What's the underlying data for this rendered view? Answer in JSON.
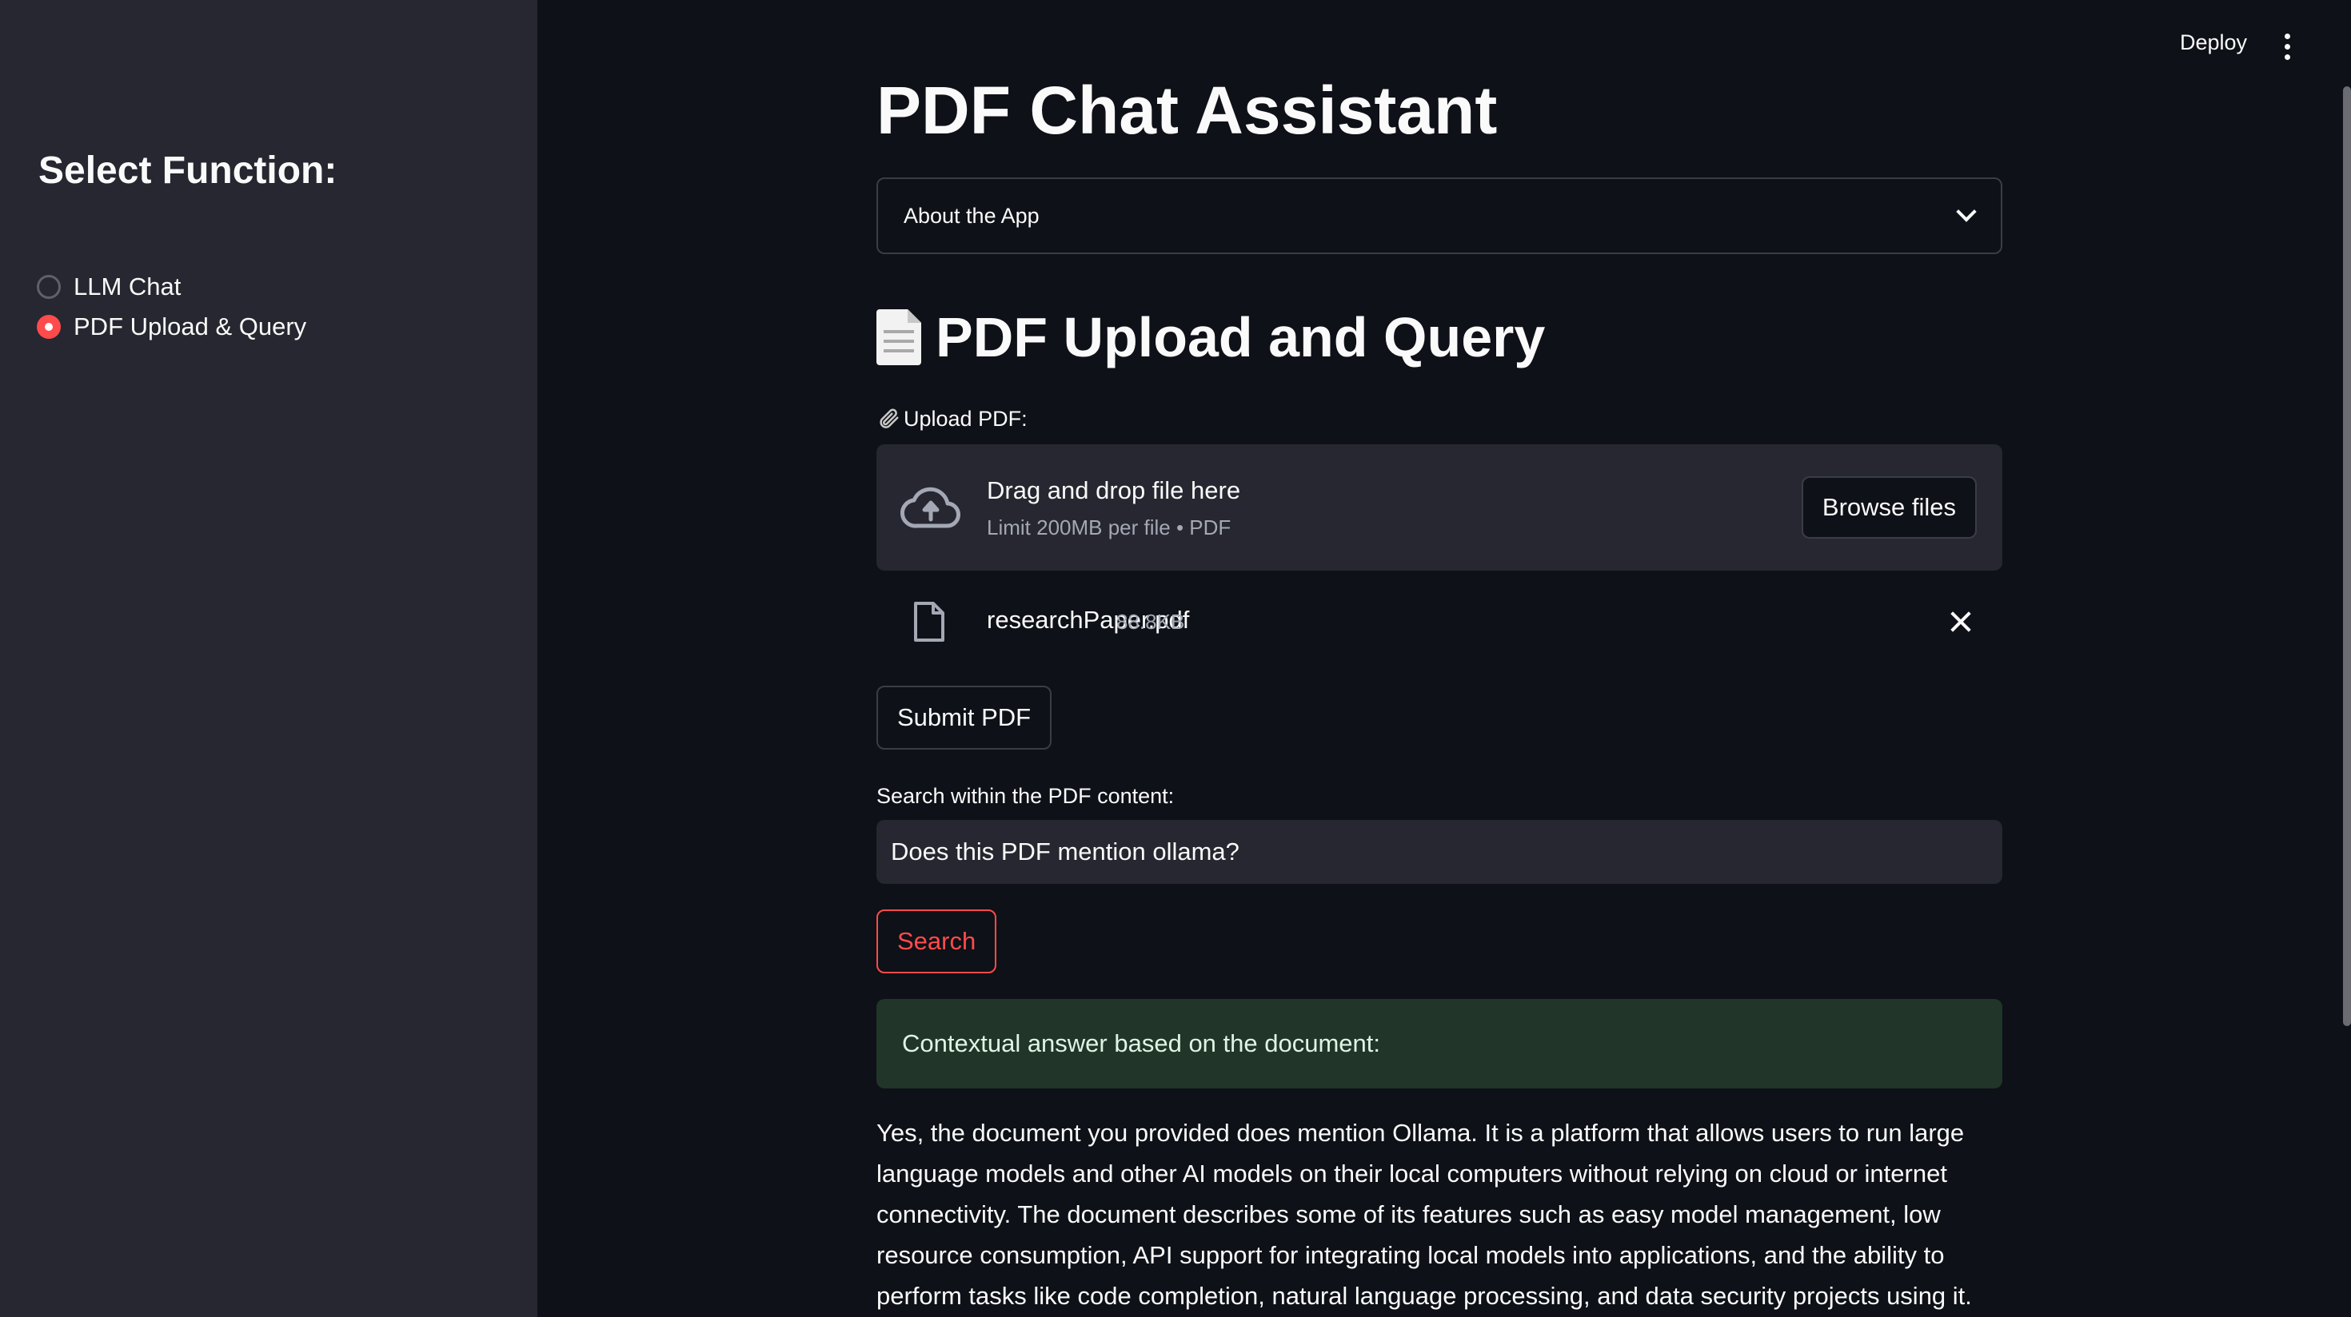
{
  "sidebar": {
    "title": "Select Function:",
    "options": [
      {
        "label": "LLM Chat",
        "selected": false
      },
      {
        "label": "PDF Upload & Query",
        "selected": true
      }
    ]
  },
  "header": {
    "deploy_label": "Deploy",
    "menu_icon": "more-vertical-icon"
  },
  "main": {
    "title": "PDF Chat Assistant",
    "expander_label": "About the App",
    "section_title": "PDF Upload and Query",
    "section_icon": "page-facing-up-icon",
    "upload": {
      "label": "Upload PDF:",
      "label_icon": "paperclip-icon",
      "drop_text": "Drag and drop file here",
      "limit_text": "Limit 200MB per file • PDF",
      "browse_label": "Browse files",
      "file": {
        "name": "researchPaper.pdf",
        "size": "88.8KB"
      }
    },
    "submit_label": "Submit PDF",
    "search": {
      "label": "Search within the PDF content:",
      "value": "Does this PDF mention ollama?",
      "button_label": "Search"
    },
    "success_text": "Contextual answer based on the document:",
    "answer_text": "Yes, the document you provided does mention Ollama. It is a platform that allows users to run large language models and other AI models on their local computers without relying on cloud or internet connectivity. The document describes some of its features such as easy model management, low resource consumption, API support for integrating local models into applications, and the ability to perform tasks like code completion, natural language processing, and data security projects using it."
  },
  "colors": {
    "background": "#0e1117",
    "sidebar": "#262730",
    "accent": "#ff4b4b",
    "success_bg": "#213529"
  }
}
